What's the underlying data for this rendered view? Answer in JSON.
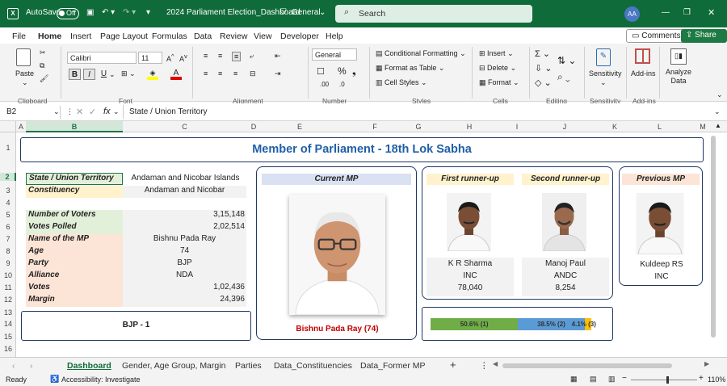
{
  "titlebar": {
    "autosave": "AutoSave",
    "toggle": "Off",
    "filename": "2024 Parliament Election_Dashboard",
    "sensitivity": "General",
    "search": "Search",
    "user": "AA"
  },
  "menu": [
    "File",
    "Home",
    "Insert",
    "Page Layout",
    "Formulas",
    "Data",
    "Review",
    "View",
    "Developer",
    "Help"
  ],
  "comments": "Comments",
  "share": "Share",
  "ribbon": {
    "paste": "Paste",
    "clipboard": "Clipboard",
    "font_name": "Calibri",
    "font_size": "11",
    "font": "Font",
    "alignment": "Alignment",
    "number_format": "General",
    "number": "Number",
    "cond_fmt": "Conditional Formatting",
    "fmt_table": "Format as Table",
    "cell_styles": "Cell Styles",
    "styles": "Styles",
    "insert": "Insert",
    "delete": "Delete",
    "format": "Format",
    "cells": "Cells",
    "editing": "Editing",
    "sensitivity": "Sensitivity",
    "addins": "Add-ins",
    "analyze": "Analyze Data",
    "addins_grp": "Add-ins"
  },
  "formula": {
    "namebox": "B2",
    "fx": "fx",
    "value": "State / Union Territory"
  },
  "cols": [
    "A",
    "B",
    "C",
    "D",
    "E",
    "F",
    "G",
    "H",
    "I",
    "J",
    "K",
    "L",
    "M"
  ],
  "rows": [
    "1",
    "2",
    "3",
    "4",
    "5",
    "6",
    "7",
    "8",
    "9",
    "10",
    "11",
    "12",
    "13",
    "14",
    "15",
    "16"
  ],
  "dashboard": {
    "title": "Member of Parliament - 18th Lok Sabha",
    "fields": [
      {
        "label": "State / Union Territory",
        "value": "Andaman and Nicobar Islands"
      },
      {
        "label": "Constituency",
        "value": "Andaman and Nicobar"
      },
      {
        "label": "Number of Voters",
        "value": "3,15,148"
      },
      {
        "label": "Votes Polled",
        "value": "2,02,514"
      },
      {
        "label": "Name of the MP",
        "value": "Bishnu Pada Ray"
      },
      {
        "label": "Age",
        "value": "74"
      },
      {
        "label": "Party",
        "value": "BJP"
      },
      {
        "label": "Alliance",
        "value": "NDA"
      },
      {
        "label": "Votes",
        "value": "1,02,436"
      },
      {
        "label": "Margin",
        "value": "24,396"
      }
    ],
    "party_box": "BJP - 1",
    "current_mp": {
      "header": "Current MP",
      "caption": "Bishnu Pada Ray (74)"
    },
    "first": {
      "header": "First runner-up",
      "name": "K R Sharma",
      "party": "INC",
      "votes": "78,040"
    },
    "second": {
      "header": "Second runner-up",
      "name": "Manoj Paul",
      "party": "ANDC",
      "votes": "8,254"
    },
    "previous": {
      "header": "Previous MP",
      "name": "Kuldeep RS",
      "party": "INC"
    },
    "bar": [
      {
        "label": "50.6% (1)",
        "pct": 50.6,
        "color": "#70ad47"
      },
      {
        "label": "38.5% (2)",
        "pct": 38.5,
        "color": "#5b9bd5"
      },
      {
        "label": "4.1% (3)",
        "pct": 4.1,
        "color": "#ffc000"
      }
    ]
  },
  "tabs": [
    "Dashboard",
    "Gender, Age Group, Margin",
    "Parties",
    "Data_Constituencies",
    "Data_Former MP"
  ],
  "status": {
    "ready": "Ready",
    "access": "Accessibility: Investigate",
    "zoom": "110%"
  }
}
